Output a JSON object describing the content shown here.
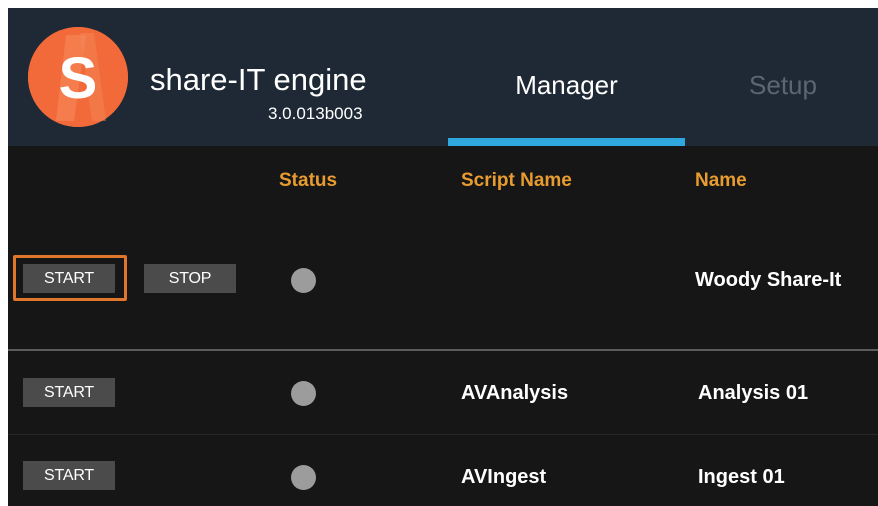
{
  "header": {
    "logo_icon": "share-it-s-logo-icon",
    "logo_letter": "S",
    "logo_color": "#f26a3a",
    "app_title": "share-IT engine",
    "version": "3.0.013b003"
  },
  "tabs": [
    {
      "label": "Manager",
      "active": true
    },
    {
      "label": "Setup",
      "active": false
    }
  ],
  "accent_color": "#2fa8e0",
  "table": {
    "columns": [
      "Status",
      "Script Name",
      "Name"
    ],
    "rows": [
      {
        "start_label": "START",
        "stop_label": "STOP",
        "status": "idle",
        "script_name": "",
        "name": "Woody Share-It",
        "focused": true
      },
      {
        "start_label": "START",
        "status": "idle",
        "script_name": "AVAnalysis",
        "name": "Analysis 01"
      },
      {
        "start_label": "START",
        "status": "idle",
        "script_name": "AVIngest",
        "name": "Ingest 01"
      }
    ]
  }
}
